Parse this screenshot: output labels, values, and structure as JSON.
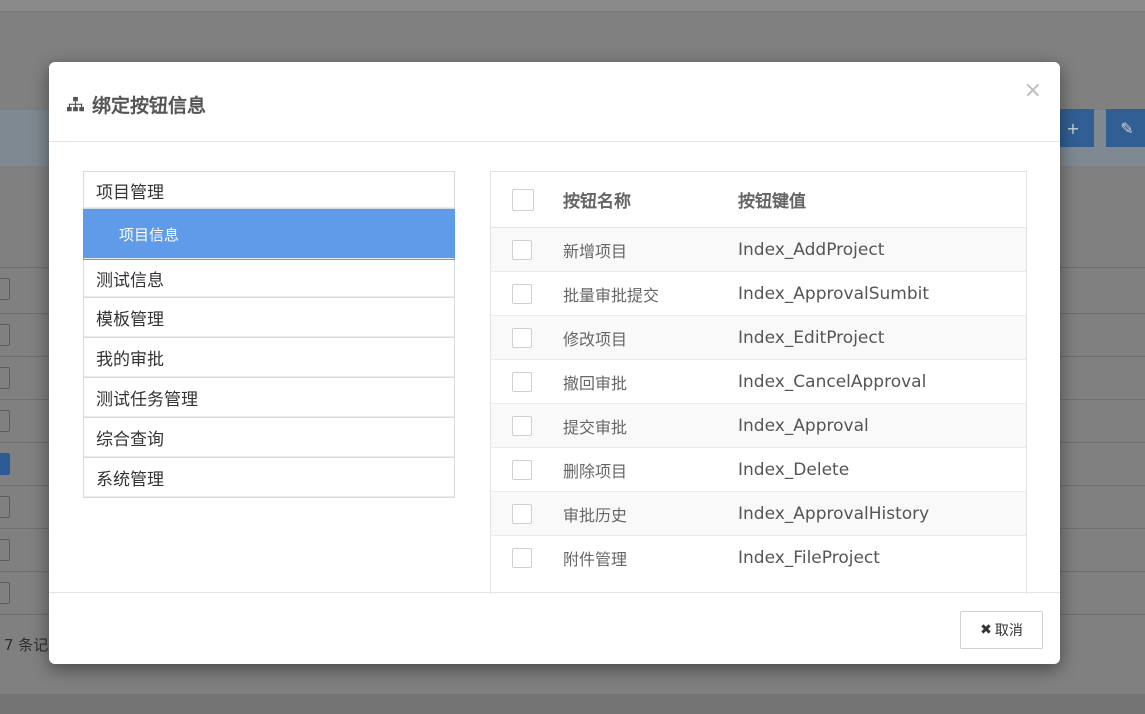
{
  "background": {
    "footer_text": "7 条记",
    "header_buttons": [
      {
        "icon": "plus-icon",
        "glyph": "+"
      },
      {
        "icon": "edit-icon",
        "glyph": "✎"
      }
    ]
  },
  "modal": {
    "title": "绑定按钮信息",
    "title_icon": "sitemap-icon",
    "close_glyph": "×",
    "tree": {
      "items": [
        {
          "label": "项目管理",
          "selected": false
        },
        {
          "label": "项目信息",
          "selected": true
        },
        {
          "label": "测试信息",
          "selected": false
        },
        {
          "label": "模板管理",
          "selected": false
        },
        {
          "label": "我的审批",
          "selected": false
        },
        {
          "label": "测试任务管理",
          "selected": false
        },
        {
          "label": "综合查询",
          "selected": false
        },
        {
          "label": "系统管理",
          "selected": false
        }
      ]
    },
    "table": {
      "columns": {
        "name": "按钮名称",
        "key": "按钮键值"
      },
      "rows": [
        {
          "name": "新增项目",
          "key": "Index_AddProject",
          "checked": false
        },
        {
          "name": "批量审批提交",
          "key": "Index_ApprovalSumbit",
          "checked": false
        },
        {
          "name": "修改项目",
          "key": "Index_EditProject",
          "checked": false
        },
        {
          "name": "撤回审批",
          "key": "Index_CancelApproval",
          "checked": false
        },
        {
          "name": "提交审批",
          "key": "Index_Approval",
          "checked": false
        },
        {
          "name": "删除项目",
          "key": "Index_Delete",
          "checked": false
        },
        {
          "name": "审批历史",
          "key": "Index_ApprovalHistory",
          "checked": false
        },
        {
          "name": "附件管理",
          "key": "Index_FileProject",
          "checked": false
        }
      ]
    },
    "footer": {
      "cancel_label": "取消",
      "cancel_icon": "times-icon",
      "cancel_glyph": "✖"
    }
  },
  "colors": {
    "selected_bg": "#5f9be8",
    "overlay": "#808080",
    "bg_button": "#315f93"
  }
}
